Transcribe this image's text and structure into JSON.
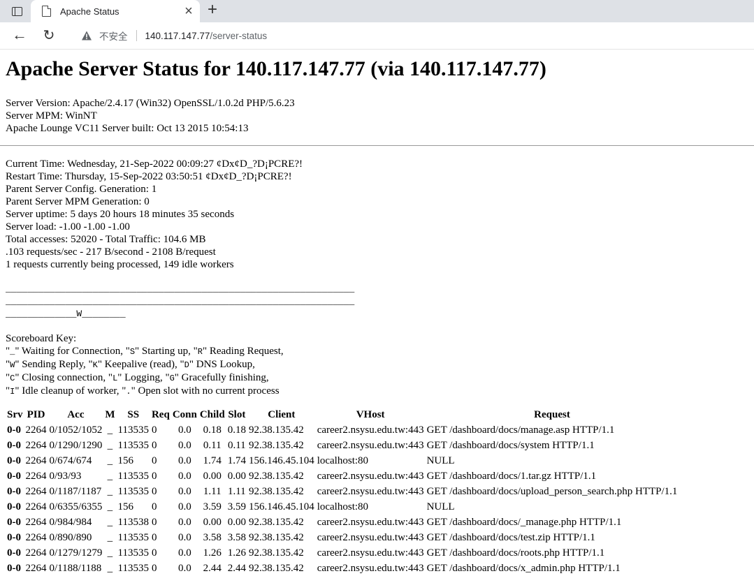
{
  "browser": {
    "tab_title": "Apache Status",
    "insecure_label": "不安全",
    "url_host": "140.117.147.77",
    "url_path": "/server-status"
  },
  "page": {
    "heading": "Apache Server Status for 140.117.147.77 (via 140.117.147.77)",
    "server_info": [
      "Server Version: Apache/2.4.17 (Win32) OpenSSL/1.0.2d PHP/5.6.23",
      "Server MPM: WinNT",
      "Apache Lounge VC11 Server built: Oct 13 2015 10:54:13"
    ],
    "status_lines": [
      "Current Time: Wednesday, 21-Sep-2022 00:09:27 ¢Dx¢D_?D¡PCRE?!",
      "Restart Time: Thursday, 15-Sep-2022 03:50:51 ¢Dx¢D_?D¡PCRE?!",
      "Parent Server Config. Generation: 1",
      "Parent Server MPM Generation: 0",
      "Server uptime: 5 days 20 hours 18 minutes 35 seconds",
      "Server load: -1.00 -1.00 -1.00",
      "Total accesses: 52020 - Total Traffic: 104.6 MB",
      ".103 requests/sec - 217 B/second - 2108 B/request",
      "1 requests currently being processed, 149 idle workers"
    ],
    "scoreboard": [
      "________________________________________________________________",
      "________________________________________________________________",
      "_____________W________"
    ],
    "scoreboard_key_title": "Scoreboard Key:",
    "scoreboard_key": [
      [
        [
          "text",
          "\""
        ],
        [
          "code",
          "_"
        ],
        [
          "text",
          "\" Waiting for Connection, \""
        ],
        [
          "code",
          "S"
        ],
        [
          "text",
          "\" Starting up, \""
        ],
        [
          "code",
          "R"
        ],
        [
          "text",
          "\" Reading Request,"
        ]
      ],
      [
        [
          "text",
          "\""
        ],
        [
          "code",
          "W"
        ],
        [
          "text",
          "\" Sending Reply, \""
        ],
        [
          "code",
          "K"
        ],
        [
          "text",
          "\" Keepalive (read), \""
        ],
        [
          "code",
          "D"
        ],
        [
          "text",
          "\" DNS Lookup,"
        ]
      ],
      [
        [
          "text",
          "\""
        ],
        [
          "code",
          "C"
        ],
        [
          "text",
          "\" Closing connection, \""
        ],
        [
          "code",
          "L"
        ],
        [
          "text",
          "\" Logging, \""
        ],
        [
          "code",
          "G"
        ],
        [
          "text",
          "\" Gracefully finishing,"
        ]
      ],
      [
        [
          "text",
          "\""
        ],
        [
          "code",
          "I"
        ],
        [
          "text",
          "\" Idle cleanup of worker, \""
        ],
        [
          "code",
          "."
        ],
        [
          "text",
          "\" Open slot with no current process"
        ]
      ]
    ],
    "table": {
      "headers": [
        "Srv",
        "PID",
        "Acc",
        "M",
        "SS",
        "Req",
        "Conn",
        "Child",
        "Slot",
        "Client",
        "VHost",
        "Request"
      ],
      "rows": [
        [
          "0-0",
          "2264",
          "0/1052/1052",
          "_",
          "113535",
          "0",
          "0.0",
          "0.18",
          "0.18",
          "92.38.135.42",
          "career2.nsysu.edu.tw:443",
          "GET /dashboard/docs/manage.asp HTTP/1.1"
        ],
        [
          "0-0",
          "2264",
          "0/1290/1290",
          "_",
          "113535",
          "0",
          "0.0",
          "0.11",
          "0.11",
          "92.38.135.42",
          "career2.nsysu.edu.tw:443",
          "GET /dashboard/docs/system HTTP/1.1"
        ],
        [
          "0-0",
          "2264",
          "0/674/674",
          "_",
          "156",
          "0",
          "0.0",
          "1.74",
          "1.74",
          "156.146.45.104",
          "localhost:80",
          "NULL"
        ],
        [
          "0-0",
          "2264",
          "0/93/93",
          "_",
          "113535",
          "0",
          "0.0",
          "0.00",
          "0.00",
          "92.38.135.42",
          "career2.nsysu.edu.tw:443",
          "GET /dashboard/docs/1.tar.gz HTTP/1.1"
        ],
        [
          "0-0",
          "2264",
          "0/1187/1187",
          "_",
          "113535",
          "0",
          "0.0",
          "1.11",
          "1.11",
          "92.38.135.42",
          "career2.nsysu.edu.tw:443",
          "GET /dashboard/docs/upload_person_search.php HTTP/1.1"
        ],
        [
          "0-0",
          "2264",
          "0/6355/6355",
          "_",
          "156",
          "0",
          "0.0",
          "3.59",
          "3.59",
          "156.146.45.104",
          "localhost:80",
          "NULL"
        ],
        [
          "0-0",
          "2264",
          "0/984/984",
          "_",
          "113538",
          "0",
          "0.0",
          "0.00",
          "0.00",
          "92.38.135.42",
          "career2.nsysu.edu.tw:443",
          "GET /dashboard/docs/_manage.php HTTP/1.1"
        ],
        [
          "0-0",
          "2264",
          "0/890/890",
          "_",
          "113535",
          "0",
          "0.0",
          "3.58",
          "3.58",
          "92.38.135.42",
          "career2.nsysu.edu.tw:443",
          "GET /dashboard/docs/test.zip HTTP/1.1"
        ],
        [
          "0-0",
          "2264",
          "0/1279/1279",
          "_",
          "113535",
          "0",
          "0.0",
          "1.26",
          "1.26",
          "92.38.135.42",
          "career2.nsysu.edu.tw:443",
          "GET /dashboard/docs/roots.php HTTP/1.1"
        ],
        [
          "0-0",
          "2264",
          "0/1188/1188",
          "_",
          "113535",
          "0",
          "0.0",
          "2.44",
          "2.44",
          "92.38.135.42",
          "career2.nsysu.edu.tw:443",
          "GET /dashboard/docs/x_admin.php HTTP/1.1"
        ]
      ]
    }
  }
}
